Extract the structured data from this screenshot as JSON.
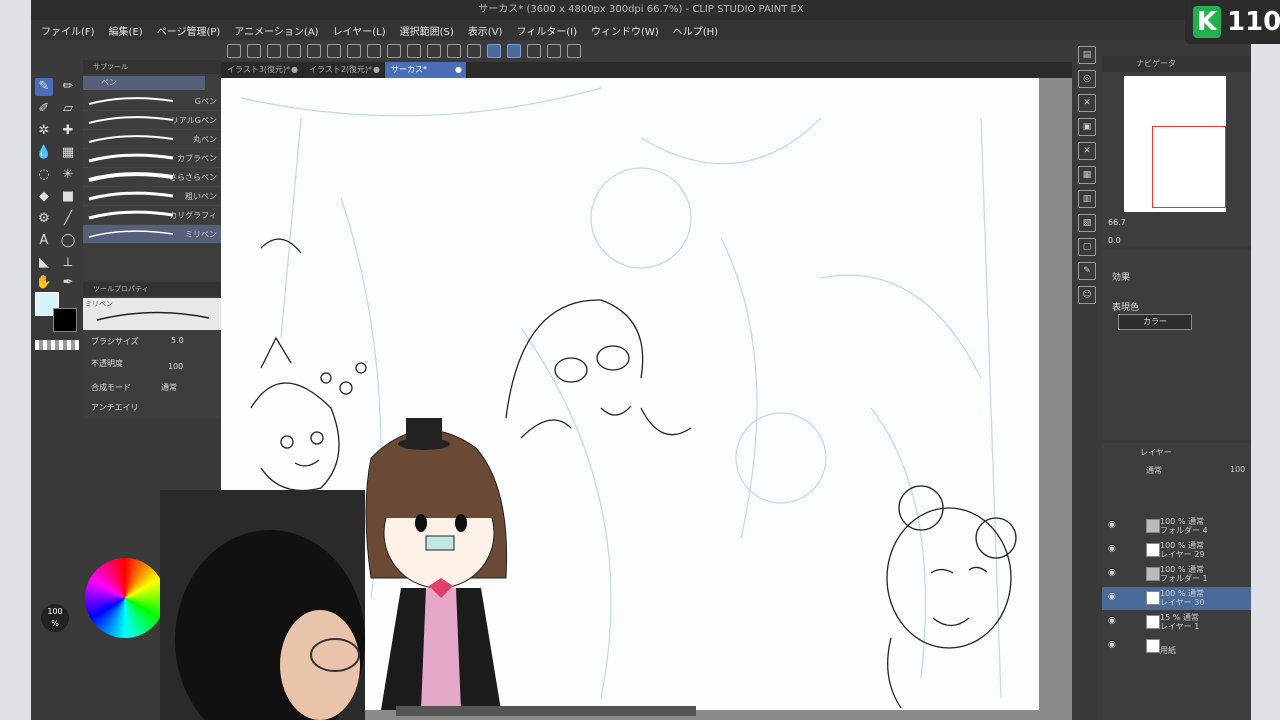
{
  "window": {
    "title": "サーカス* (3600 x 4800px 300dpi 66.7%)  - CLIP STUDIO PAINT EX"
  },
  "menu": [
    "ファイル(F)",
    "編集(E)",
    "ページ管理(P)",
    "アニメーション(A)",
    "レイヤー(L)",
    "選択範囲(S)",
    "表示(V)",
    "フィルター(I)",
    "ウィンドウ(W)",
    "ヘルプ(H)"
  ],
  "doc_tabs": [
    {
      "label": "イラスト3(復元)*",
      "active": false
    },
    {
      "label": "イラスト2(復元)*",
      "active": false
    },
    {
      "label": "サーカス*",
      "active": true
    }
  ],
  "subtool": {
    "title": "サブツール",
    "group": "ペン",
    "pens": [
      "Gペン",
      "リアルGペン",
      "丸ペン",
      "カブラペン",
      "さらさらペン",
      "粗いペン",
      "カリグラフィ",
      "ミリペン"
    ],
    "selected_index": 7
  },
  "tool_property": {
    "title": "ツールプロパティ",
    "current": "ミリペン",
    "brush_size_label": "ブラシサイズ",
    "brush_size": "5.0",
    "opacity_label": "不透明度",
    "opacity": "100",
    "blend_label": "合成モード",
    "blend_value": "通常",
    "aa_label": "アンチエイリ"
  },
  "colors": {
    "main": "#d8f4fa",
    "sub": "#000000",
    "accent": "#4a6fb8"
  },
  "color_wheel": {
    "opacity": "100",
    "unit": "%"
  },
  "navigator": {
    "title": "ナビゲータ",
    "zoom": "66.7",
    "rotation": "0.0"
  },
  "effects": {
    "title": "効果",
    "expression_label": "表現色",
    "expression_value": "カラー"
  },
  "layers": {
    "title": "レイヤー",
    "blend": "通常",
    "opacity": "100",
    "items": [
      {
        "line1": "100 % 通常",
        "line2": "フォルダー 4",
        "type": "folder",
        "selected": false
      },
      {
        "line1": "100 % 通常",
        "line2": "レイヤー 29",
        "type": "raster",
        "selected": false
      },
      {
        "line1": "100 % 通常",
        "line2": "フォルダー 1",
        "type": "folder",
        "selected": false
      },
      {
        "line1": "100 % 通常",
        "line2": "レイヤー 30",
        "type": "raster",
        "selected": true
      },
      {
        "line1": "15 % 通常",
        "line2": "レイヤー 1",
        "type": "raster",
        "selected": false
      },
      {
        "line1": "",
        "line2": "用紙",
        "type": "paper",
        "selected": false
      }
    ]
  },
  "stream_badge": {
    "letter": "K",
    "number": "110"
  }
}
